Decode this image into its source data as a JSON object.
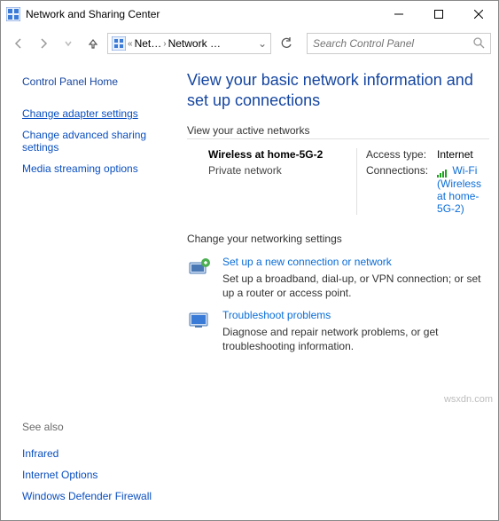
{
  "titlebar": {
    "title": "Network and Sharing Center"
  },
  "toolbar": {
    "crumb1": "Net…",
    "crumb2": "Network …",
    "search_placeholder": "Search Control Panel"
  },
  "sidebar": {
    "home": "Control Panel Home",
    "links": {
      "adapter": "Change adapter settings",
      "advanced": "Change advanced sharing settings",
      "media": "Media streaming options"
    },
    "seealso_h": "See also",
    "seealso": {
      "infrared": "Infrared",
      "inet": "Internet Options",
      "firewall": "Windows Defender Firewall"
    }
  },
  "main": {
    "heading": "View your basic network information and set up connections",
    "active_h": "View your active networks",
    "net_name": "Wireless at home-5G-2",
    "net_type": "Private network",
    "access_lbl": "Access type:",
    "access_val": "Internet",
    "conn_lbl": "Connections:",
    "conn_val": "Wi-Fi (Wireless at home-5G-2)",
    "change_h": "Change your networking settings",
    "setup_ttl": "Set up a new connection or network",
    "setup_desc": "Set up a broadband, dial-up, or VPN connection; or set up a router or access point.",
    "trouble_ttl": "Troubleshoot problems",
    "trouble_desc": "Diagnose and repair network problems, or get troubleshooting information."
  },
  "watermark": "wsxdn.com"
}
